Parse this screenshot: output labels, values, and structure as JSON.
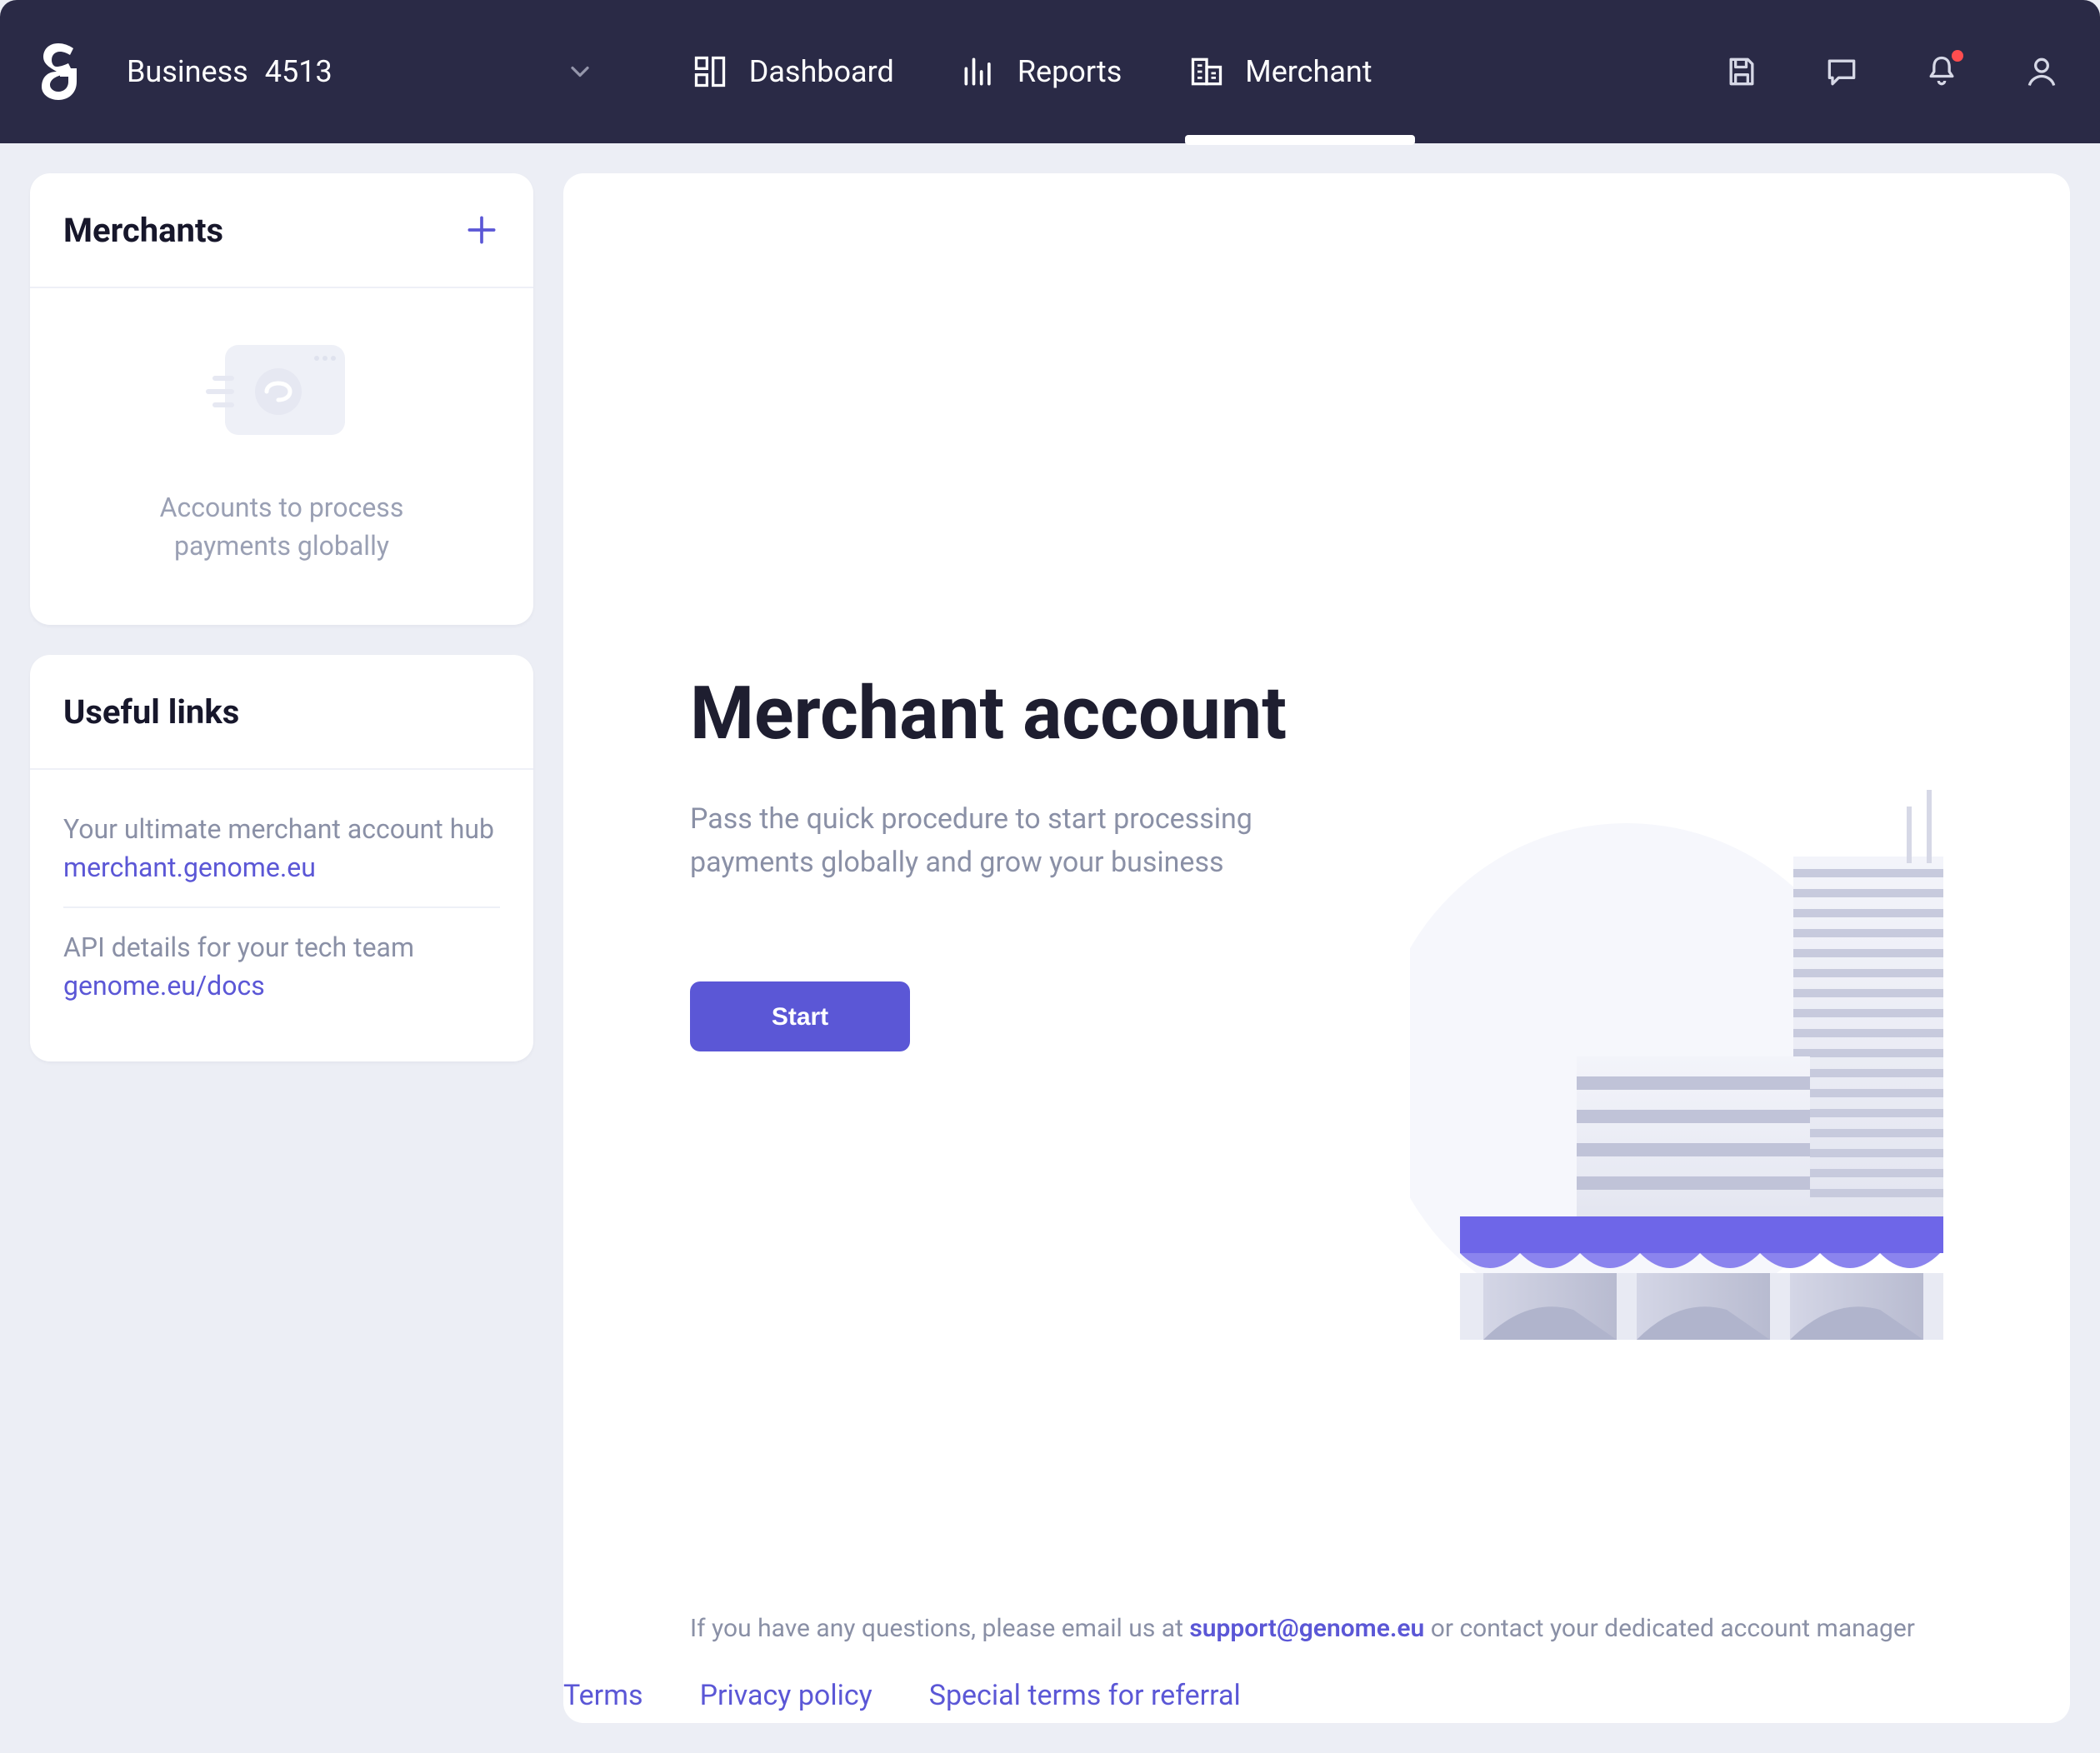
{
  "header": {
    "account_type": "Business",
    "account_id": "4513",
    "nav": [
      {
        "label": "Dashboard",
        "active": false
      },
      {
        "label": "Reports",
        "active": false
      },
      {
        "label": "Merchant",
        "active": true
      }
    ]
  },
  "sidebar": {
    "merchants": {
      "title": "Merchants",
      "empty_text_line1": "Accounts to process",
      "empty_text_line2": "payments globally"
    },
    "useful_links": {
      "title": "Useful links",
      "items": [
        {
          "desc": "Your ultimate merchant account hub",
          "url": "merchant.genome.eu"
        },
        {
          "desc": "API details for your tech team",
          "url": "genome.eu/docs"
        }
      ]
    }
  },
  "main": {
    "title": "Merchant account",
    "subtitle": "Pass the quick procedure  to start processing payments globally and grow your business",
    "start_label": "Start",
    "footer_prefix": "If you have any questions, please email us at ",
    "footer_email": "support@genome.eu",
    "footer_suffix": " or contact your dedicated account manager"
  },
  "bottom_links": [
    "Terms",
    "Privacy policy",
    "Special terms for referral"
  ],
  "colors": {
    "header_bg": "#2a2a46",
    "accent": "#5b57d6",
    "muted": "#8a90a6",
    "page_bg": "#eceef5",
    "annotation_arrow": "#f25c54"
  }
}
